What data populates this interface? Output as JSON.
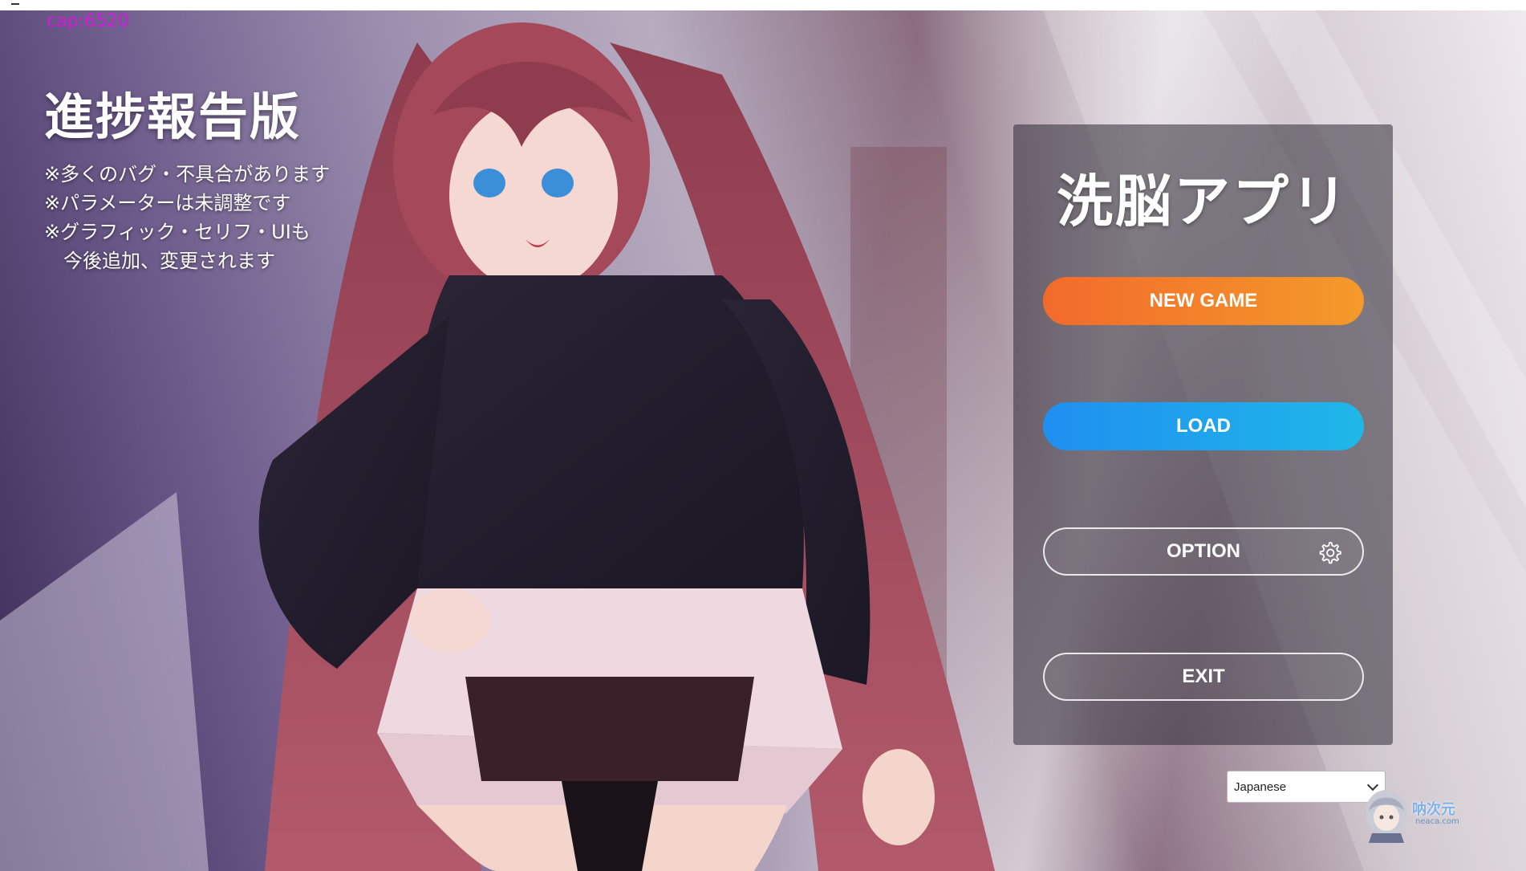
{
  "overlay": {
    "cap_counter": "cap:6520"
  },
  "notice": {
    "title": "進捗報告版",
    "lines": [
      "※多くのバグ・不具合があります",
      "※パラメーターは未調整です",
      "※グラフィック・セリフ・UIも",
      "今後追加、変更されます"
    ]
  },
  "menu": {
    "title": "洗脳アプリ",
    "new_game": "NEW GAME",
    "load": "LOAD",
    "option": "OPTION",
    "exit": "EXIT"
  },
  "language": {
    "selected": "Japanese"
  },
  "watermark": {
    "name": "呐次元",
    "site": "neaca.com"
  },
  "colors": {
    "new_game_gradient": [
      "#f26a2b",
      "#f49a2a"
    ],
    "load_gradient": [
      "#1f8ff0",
      "#1fb7e8"
    ],
    "cap_text": "#d21bd8"
  },
  "icons": {
    "option": "gear-icon",
    "language_dropdown": "chevron-down-icon"
  }
}
